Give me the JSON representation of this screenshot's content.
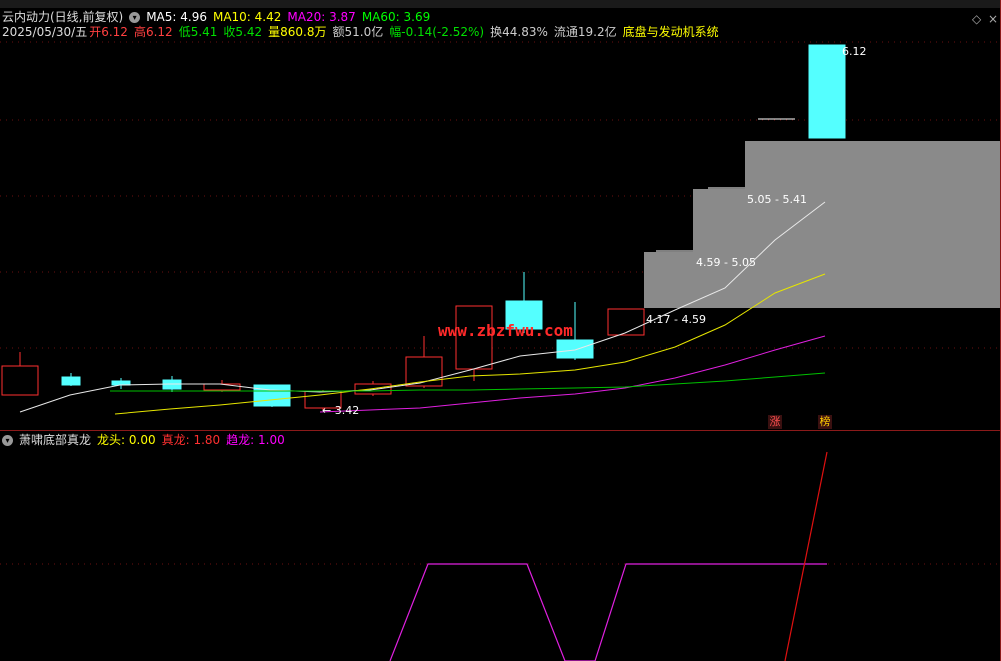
{
  "header": {
    "title": "云内动力(日线,前复权)",
    "ma_items": [
      {
        "label": "MA5: 4.96",
        "color": "#ffffff"
      },
      {
        "label": "MA10: 4.42",
        "color": "#ffff00"
      },
      {
        "label": "MA20: 3.87",
        "color": "#ff00ff"
      },
      {
        "label": "MA60: 3.69",
        "color": "#00ff00"
      }
    ],
    "date": "2025/05/30/五",
    "quote_items": [
      {
        "label": "开6.12",
        "color": "#ff4040"
      },
      {
        "label": "高6.12",
        "color": "#ff4040"
      },
      {
        "label": "低5.41",
        "color": "#00e000"
      },
      {
        "label": "收5.42",
        "color": "#00e000"
      },
      {
        "label": "量860.8万",
        "color": "#ffff00"
      },
      {
        "label": "额51.0亿",
        "color": "#cccccc"
      },
      {
        "label": "幅-0.14(-2.52%)",
        "color": "#00e000"
      },
      {
        "label": "换44.83%",
        "color": "#cccccc"
      },
      {
        "label": "流通19.2亿",
        "color": "#cccccc"
      },
      {
        "label": "底盘与发动机系统",
        "color": "#ffff00"
      }
    ],
    "controls": {
      "diamond": "◇",
      "close": "×"
    }
  },
  "main_chart": {
    "high_label": "6.12",
    "low_label": "← 3.42",
    "ranges": [
      "5.05 - 5.41",
      "4.59 - 5.05",
      "4.17 - 4.59"
    ],
    "badges": [
      {
        "text": "涨",
        "color": "#ff5050"
      },
      {
        "text": "榜",
        "color": "#ffcc00"
      }
    ],
    "watermark": "www.zbzfwu.com"
  },
  "indicator": {
    "title": "萧啸底部真龙",
    "items": [
      {
        "label": "龙头: 0.00",
        "color": "#ffff00"
      },
      {
        "label": "真龙: 1.80",
        "color": "#ff3030"
      },
      {
        "label": "趋龙: 1.00",
        "color": "#ff00ff"
      }
    ]
  },
  "icons": {
    "toggle": "circle-toggle-icon"
  }
}
